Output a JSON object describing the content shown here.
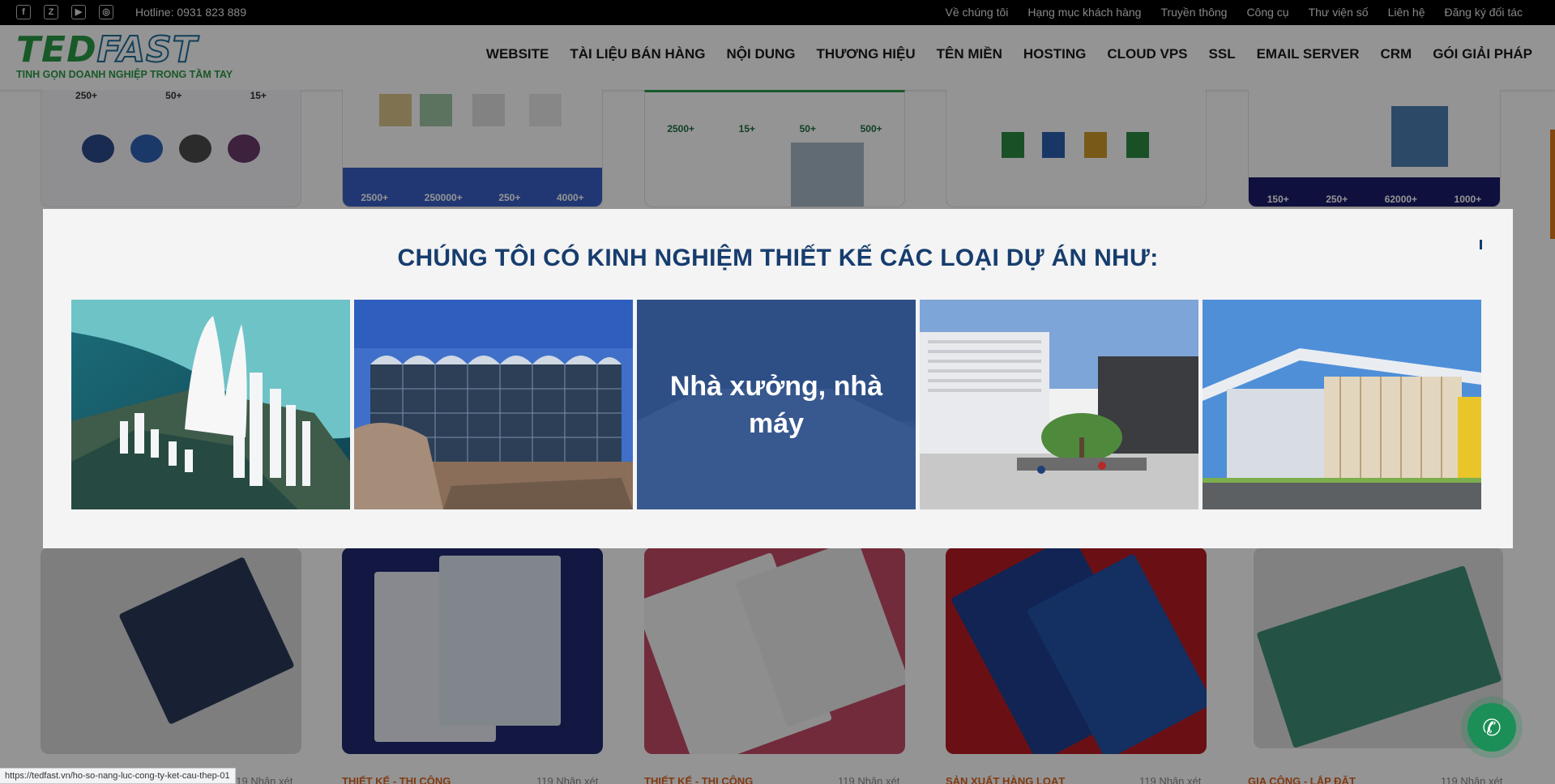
{
  "topbar": {
    "social_icons": [
      "facebook-icon",
      "zalo-icon",
      "youtube-icon",
      "instagram-icon"
    ],
    "social_glyphs": [
      "f",
      "Z",
      "▶",
      "◎"
    ],
    "hotline": "Hotline: 0931 823 889",
    "links": [
      "Về chúng tôi",
      "Hạng mục khách hàng",
      "Truyền thông",
      "Công cụ",
      "Thư viện số",
      "Liên hệ",
      "Đăng ký đối tác"
    ]
  },
  "header": {
    "logo_part1": "TED",
    "logo_part2": "FAST",
    "logo_tagline": "TINH GỌN DOANH NGHIỆP TRONG TẦM TAY",
    "nav": [
      "WEBSITE",
      "TÀI LIỆU BÁN HÀNG",
      "NỘI DUNG",
      "THƯƠNG HIỆU",
      "TÊN MIỀN",
      "HOSTING",
      "CLOUD VPS",
      "SSL",
      "EMAIL SERVER",
      "CRM",
      "GÓI GIẢI PHÁP"
    ]
  },
  "background": {
    "card1_stats": [
      "250+",
      "50+",
      "15+"
    ],
    "card2_stats": [
      "2500+",
      "250000+",
      "250+",
      "4000+"
    ],
    "card3_stats": [
      "2500+",
      "15+",
      "50+",
      "500+"
    ],
    "card5_stats": [
      "150+",
      "250+",
      "62000+",
      "1000+"
    ],
    "categories": [
      "THIẾT KẾ - THI CÔNG",
      "THIẾT KẾ - THI CÔNG",
      "SẢN XUẤT HÀNG LOẠT",
      "GIA CÔNG - LẮP ĐẶT"
    ],
    "comments": [
      "119 Nhận xét",
      "119 Nhận xét",
      "119 Nhận xét",
      "119 Nhận xét",
      "119 Nhận xét"
    ]
  },
  "modal": {
    "title": "CHÚNG TÔI CÓ KINH NGHIỆM THIẾT KẾ CÁC LOẠI DỰ ÁN NHƯ:",
    "active_caption": "Nhà xưởng, nhà máy"
  },
  "status_url": "https://tedfast.vn/ho-so-nang-luc-cong-ty-ket-cau-thep-01",
  "colors": {
    "accent": "#173d6e",
    "brand_green": "#2a9a46",
    "orange": "#e0641f",
    "phone": "#1b8f57"
  }
}
